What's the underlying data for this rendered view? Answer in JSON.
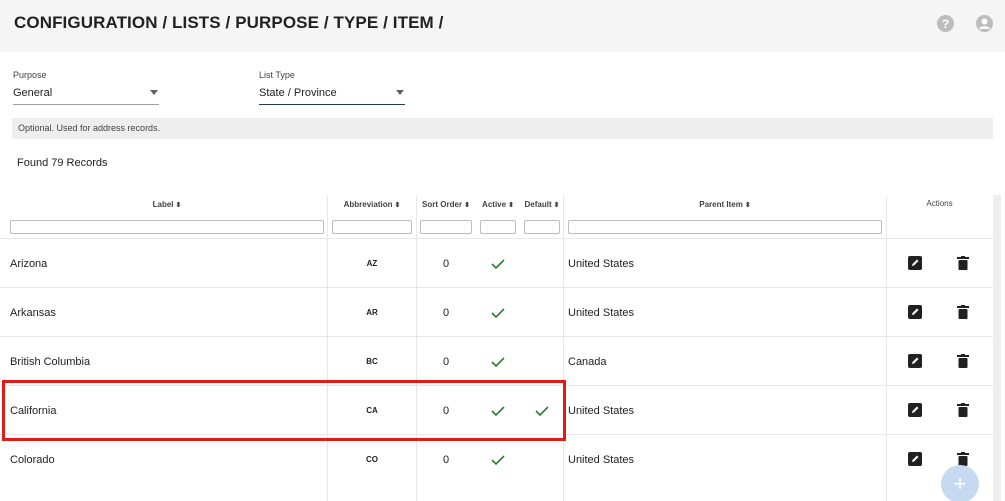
{
  "header": {
    "title": "CONFIGURATION / LISTS / PURPOSE / TYPE / ITEM /",
    "help_icon": "help-circle-icon",
    "account_icon": "account-circle-icon"
  },
  "filters": {
    "purpose": {
      "label": "Purpose",
      "value": "General"
    },
    "list_type": {
      "label": "List Type",
      "value": "State / Province"
    }
  },
  "hint": "Optional. Used for address records.",
  "found": "Found 79 Records",
  "table": {
    "columns": {
      "label": "Label",
      "abbreviation": "Abbreviation",
      "sort_order": "Sort Order",
      "active": "Active",
      "default": "Default",
      "parent_item": "Parent Item",
      "actions": "Actions"
    },
    "sort_glyph": "⬍",
    "rows": [
      {
        "label": "Arizona",
        "abbreviation": "AZ",
        "sort_order": "0",
        "active": true,
        "default": false,
        "parent_item": "United States"
      },
      {
        "label": "Arkansas",
        "abbreviation": "AR",
        "sort_order": "0",
        "active": true,
        "default": false,
        "parent_item": "United States"
      },
      {
        "label": "British Columbia",
        "abbreviation": "BC",
        "sort_order": "0",
        "active": true,
        "default": false,
        "parent_item": "Canada"
      },
      {
        "label": "California",
        "abbreviation": "CA",
        "sort_order": "0",
        "active": true,
        "default": true,
        "parent_item": "United States"
      },
      {
        "label": "Colorado",
        "abbreviation": "CO",
        "sort_order": "0",
        "active": true,
        "default": false,
        "parent_item": "United States"
      }
    ]
  },
  "colors": {
    "check": "#2e7d32",
    "highlight": "#e01b1b",
    "fab": "#c5d9f0"
  },
  "fab_icon": "plus-icon"
}
